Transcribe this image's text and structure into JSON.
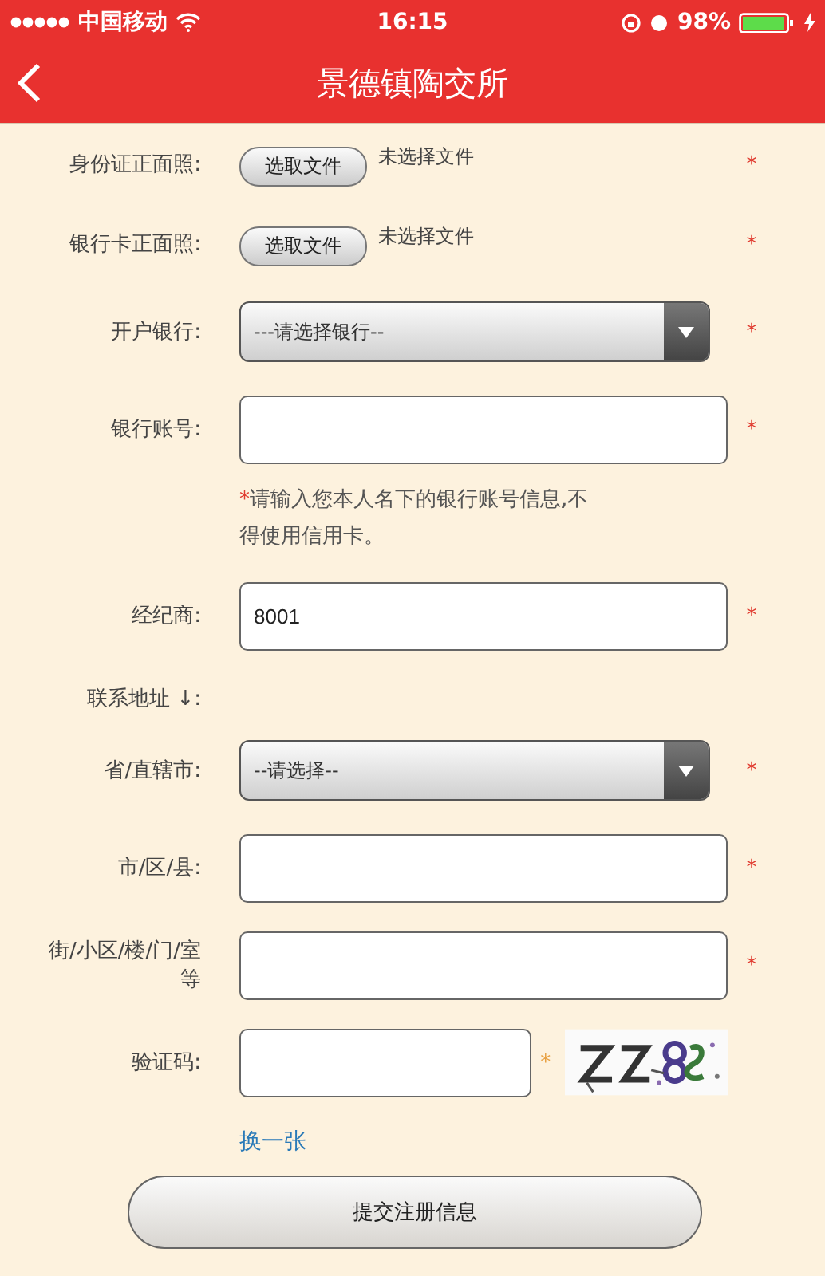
{
  "status_bar": {
    "carrier": "中国移动",
    "time": "16:15",
    "battery": "98%"
  },
  "header": {
    "title": "景德镇陶交所"
  },
  "rows": [
    {
      "kind": "file",
      "label": "身份证正面照:",
      "button": "选取文件",
      "status": "未选择文件",
      "required": true
    },
    {
      "kind": "file",
      "label": "银行卡正面照:",
      "button": "选取文件",
      "status": "未选择文件",
      "required": true
    },
    {
      "kind": "select",
      "label": "开户银行:",
      "value": "---请选择银行--",
      "required": true
    },
    {
      "kind": "input",
      "label": "银行账号:",
      "value": "",
      "required": true
    },
    {
      "kind": "note",
      "mark": "*",
      "text": "请输入您本人名下的银行账号信息,不得使用信用卡。"
    },
    {
      "kind": "input",
      "label": "经纪商:",
      "value": "8001",
      "required": true
    },
    {
      "kind": "section",
      "label": "联系地址 ↓:"
    },
    {
      "kind": "select",
      "label": "省/直辖市:",
      "value": "--请选择--",
      "required": true
    },
    {
      "kind": "input",
      "label": "市/区/县:",
      "value": "",
      "required": true
    },
    {
      "kind": "input",
      "label": "街/小区/楼/门/室等",
      "value": "",
      "required": true
    },
    {
      "kind": "captcha",
      "label": "验证码:",
      "value": "",
      "required": true,
      "link": "换一张"
    }
  ],
  "submit": "提交注册信息"
}
